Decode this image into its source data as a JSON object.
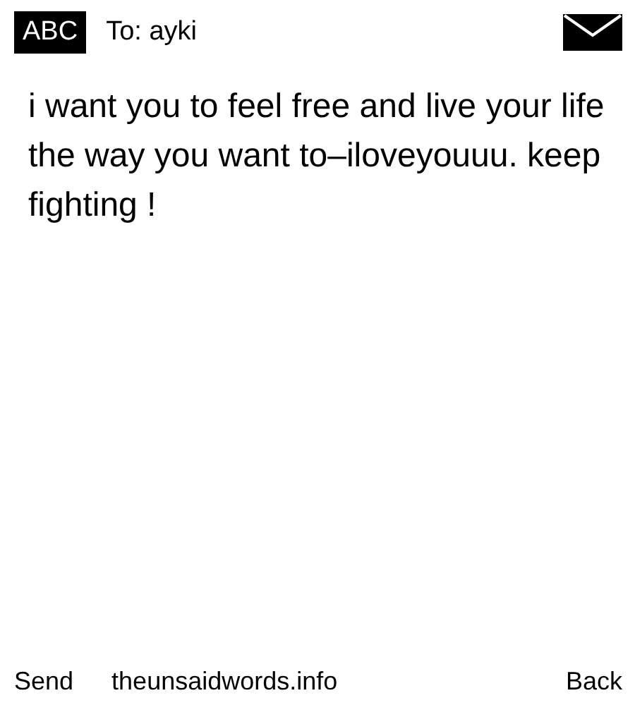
{
  "header": {
    "logo": "ABC",
    "recipient": "To: ayki"
  },
  "message": "i want you to feel free and live your life the way you want to–iloveyouuu. keep fighting !",
  "footer": {
    "send": "Send",
    "site": "theunsaidwords.info",
    "back": "Back"
  }
}
